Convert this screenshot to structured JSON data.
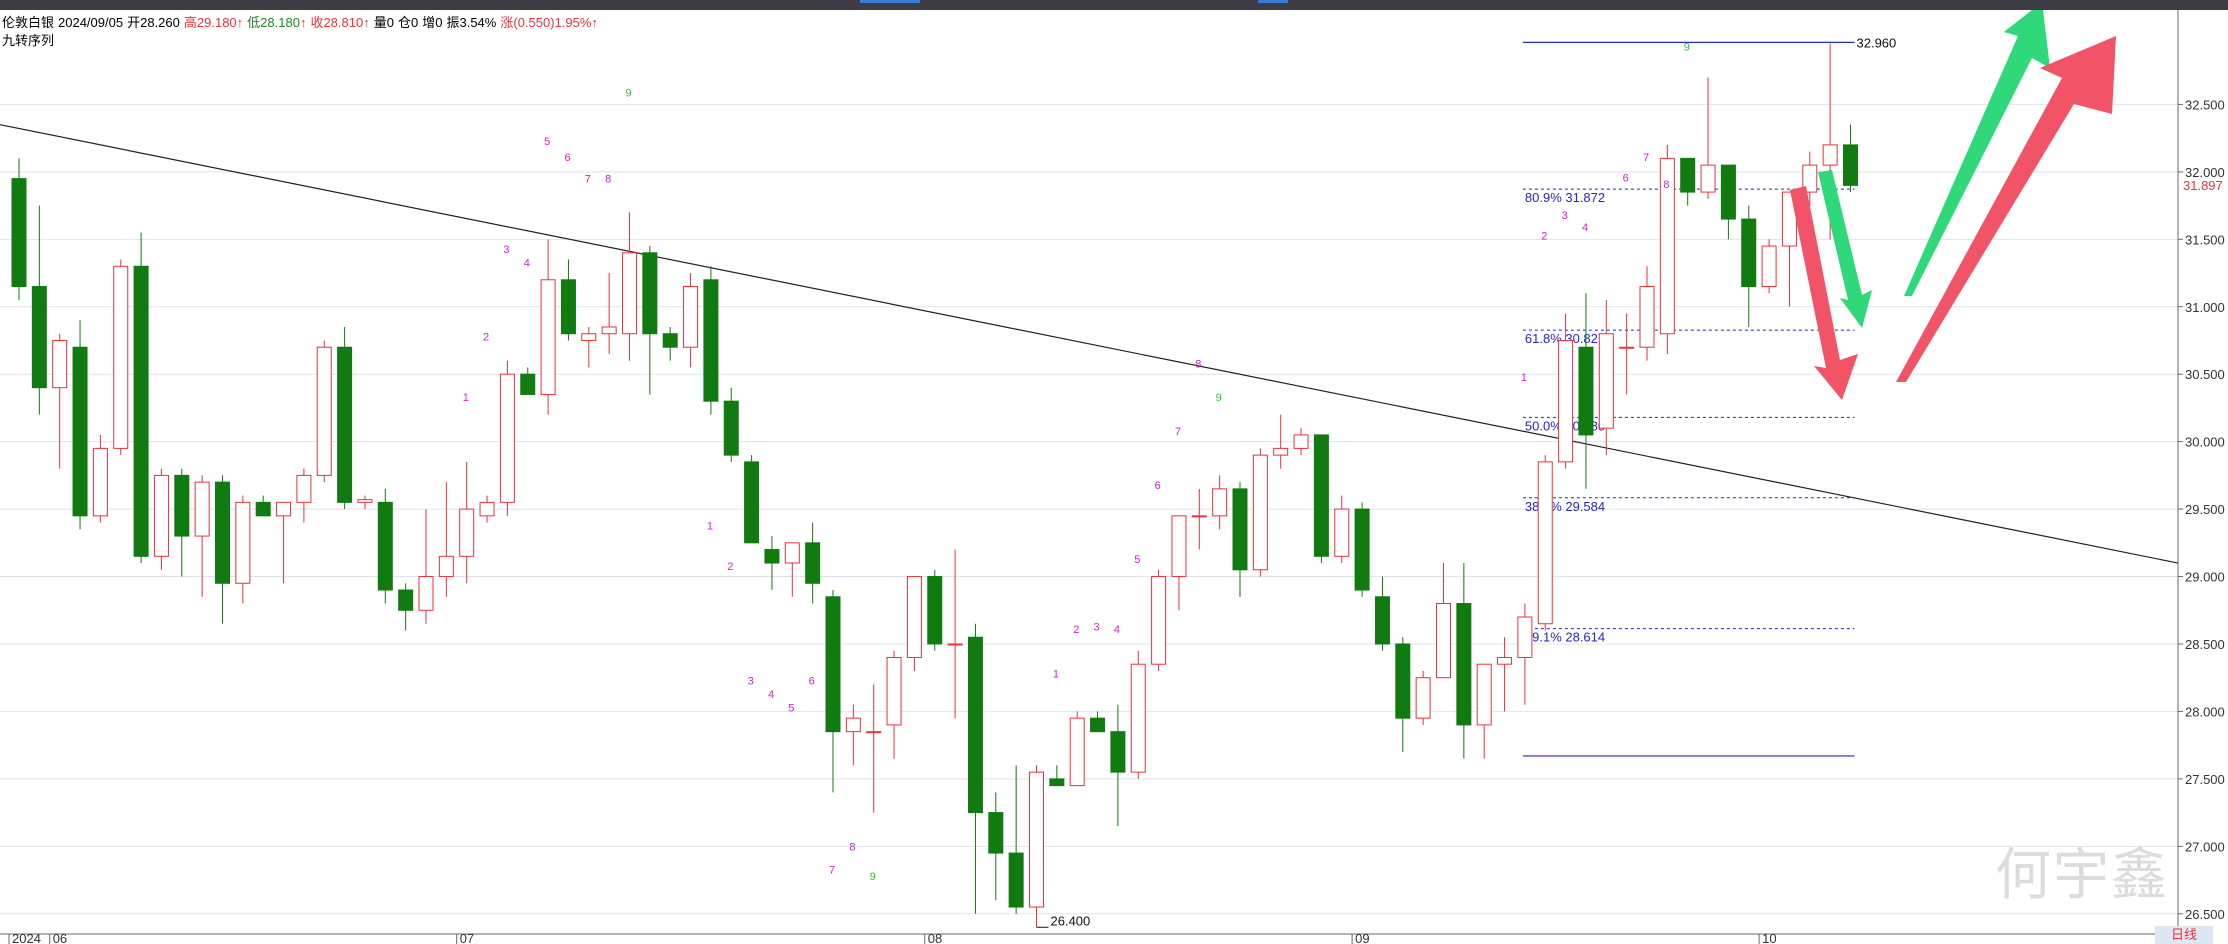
{
  "window": {
    "title_tabs": 2
  },
  "header": {
    "symbol": "伦敦白银",
    "date": "2024/09/05",
    "open_label": "开",
    "open": "28.260",
    "high_label": "高",
    "high": "29.180",
    "low_label": "低",
    "low": "28.180",
    "close_label": "收",
    "close": "28.810",
    "volume_label": "量",
    "volume": "0",
    "oi_label": "仓",
    "oi": "0",
    "inc_label": "增",
    "inc": "0",
    "amp_label": "振",
    "amp": "3.54%",
    "chg_label": "涨",
    "chg": "(0.550)1.95%",
    "up_arrow": "↑",
    "indicator": "九转序列"
  },
  "watermark": "何宇鑫",
  "period_badge": "日线",
  "colors": {
    "up": "#e8323c",
    "down": "#117a11",
    "fib": "#2525c8",
    "text_magenta": "#d21ed2",
    "text_green": "#25c825",
    "grid": "#dde3ee",
    "arrow_green": "#2fd97a",
    "arrow_red": "#f05466"
  },
  "chart_data": {
    "type": "candlestick",
    "y_axis": {
      "min": 26.35,
      "max": 33.2,
      "ticks": [
        "32.500",
        "32.000",
        "31.500",
        "31.000",
        "30.500",
        "30.000",
        "29.500",
        "29.000",
        "28.500",
        "28.000",
        "27.500",
        "27.000",
        "26.500"
      ],
      "current_price": "31.897",
      "position": "right"
    },
    "x_axis": {
      "labels": [
        {
          "text": "2024",
          "index": 0
        },
        {
          "text": "06",
          "index": 2
        },
        {
          "text": "07",
          "index": 22
        },
        {
          "text": "08",
          "index": 45
        },
        {
          "text": "09",
          "index": 66
        },
        {
          "text": "10",
          "index": 86
        }
      ]
    },
    "candles": [
      {
        "o": 31.95,
        "h": 32.1,
        "l": 31.05,
        "c": 31.15
      },
      {
        "o": 31.15,
        "h": 31.75,
        "l": 30.2,
        "c": 30.4
      },
      {
        "o": 30.4,
        "h": 30.8,
        "l": 29.8,
        "c": 30.75
      },
      {
        "o": 30.7,
        "h": 30.9,
        "l": 29.35,
        "c": 29.45
      },
      {
        "o": 29.45,
        "h": 30.05,
        "l": 29.4,
        "c": 29.95
      },
      {
        "o": 29.95,
        "h": 31.35,
        "l": 29.9,
        "c": 31.3
      },
      {
        "o": 31.3,
        "h": 31.55,
        "l": 29.1,
        "c": 29.15
      },
      {
        "o": 29.15,
        "h": 29.8,
        "l": 29.05,
        "c": 29.75
      },
      {
        "o": 29.75,
        "h": 29.8,
        "l": 29.0,
        "c": 29.3
      },
      {
        "o": 29.3,
        "h": 29.75,
        "l": 28.85,
        "c": 29.7
      },
      {
        "o": 29.7,
        "h": 29.75,
        "l": 28.65,
        "c": 28.95
      },
      {
        "o": 28.95,
        "h": 29.6,
        "l": 28.8,
        "c": 29.55
      },
      {
        "o": 29.55,
        "h": 29.6,
        "l": 29.45,
        "c": 29.45
      },
      {
        "o": 29.45,
        "h": 29.55,
        "l": 28.95,
        "c": 29.55
      },
      {
        "o": 29.55,
        "h": 29.8,
        "l": 29.4,
        "c": 29.75
      },
      {
        "o": 29.75,
        "h": 30.75,
        "l": 29.7,
        "c": 30.7
      },
      {
        "o": 30.7,
        "h": 30.85,
        "l": 29.5,
        "c": 29.55
      },
      {
        "o": 29.55,
        "h": 29.6,
        "l": 29.5,
        "c": 29.57
      },
      {
        "o": 29.55,
        "h": 29.65,
        "l": 28.8,
        "c": 28.9
      },
      {
        "o": 28.9,
        "h": 28.95,
        "l": 28.6,
        "c": 28.75
      },
      {
        "o": 28.75,
        "h": 29.5,
        "l": 28.65,
        "c": 29.0
      },
      {
        "o": 29.0,
        "h": 29.7,
        "l": 28.85,
        "c": 29.15
      },
      {
        "o": 29.15,
        "h": 29.85,
        "l": 28.95,
        "c": 29.5
      },
      {
        "o": 29.45,
        "h": 29.6,
        "l": 29.4,
        "c": 29.55
      },
      {
        "o": 29.55,
        "h": 30.6,
        "l": 29.45,
        "c": 30.5
      },
      {
        "o": 30.5,
        "h": 30.55,
        "l": 30.35,
        "c": 30.35
      },
      {
        "o": 30.35,
        "h": 31.5,
        "l": 30.2,
        "c": 31.2
      },
      {
        "o": 31.2,
        "h": 31.35,
        "l": 30.75,
        "c": 30.8
      },
      {
        "o": 30.75,
        "h": 30.85,
        "l": 30.55,
        "c": 30.8
      },
      {
        "o": 30.8,
        "h": 31.25,
        "l": 30.65,
        "c": 30.85
      },
      {
        "o": 30.8,
        "h": 31.7,
        "l": 30.6,
        "c": 31.4
      },
      {
        "o": 31.4,
        "h": 31.45,
        "l": 30.35,
        "c": 30.8
      },
      {
        "o": 30.8,
        "h": 30.85,
        "l": 30.6,
        "c": 30.7
      },
      {
        "o": 30.7,
        "h": 31.25,
        "l": 30.55,
        "c": 31.15
      },
      {
        "o": 31.2,
        "h": 31.3,
        "l": 30.2,
        "c": 30.3
      },
      {
        "o": 30.3,
        "h": 30.4,
        "l": 29.85,
        "c": 29.9
      },
      {
        "o": 29.85,
        "h": 29.9,
        "l": 29.25,
        "c": 29.25
      },
      {
        "o": 29.2,
        "h": 29.3,
        "l": 28.9,
        "c": 29.1
      },
      {
        "o": 29.1,
        "h": 29.25,
        "l": 28.85,
        "c": 29.25
      },
      {
        "o": 29.25,
        "h": 29.4,
        "l": 28.8,
        "c": 28.95
      },
      {
        "o": 28.85,
        "h": 28.9,
        "l": 27.4,
        "c": 27.85
      },
      {
        "o": 27.85,
        "h": 28.05,
        "l": 27.6,
        "c": 27.95
      },
      {
        "o": 27.85,
        "h": 28.2,
        "l": 27.25,
        "c": 27.85
      },
      {
        "o": 27.9,
        "h": 28.45,
        "l": 27.65,
        "c": 28.4
      },
      {
        "o": 28.4,
        "h": 29.0,
        "l": 28.3,
        "c": 29.0
      },
      {
        "o": 29.0,
        "h": 29.05,
        "l": 28.45,
        "c": 28.5
      },
      {
        "o": 28.5,
        "h": 29.2,
        "l": 27.95,
        "c": 28.5
      },
      {
        "o": 28.55,
        "h": 28.65,
        "l": 26.5,
        "c": 27.25
      },
      {
        "o": 27.25,
        "h": 27.4,
        "l": 26.6,
        "c": 26.95
      },
      {
        "o": 26.95,
        "h": 27.6,
        "l": 26.5,
        "c": 26.55
      },
      {
        "o": 26.55,
        "h": 27.6,
        "l": 26.4,
        "c": 27.55
      },
      {
        "o": 27.5,
        "h": 27.6,
        "l": 27.45,
        "c": 27.45
      },
      {
        "o": 27.45,
        "h": 28.0,
        "l": 27.45,
        "c": 27.95
      },
      {
        "o": 27.95,
        "h": 28.0,
        "l": 27.85,
        "c": 27.85
      },
      {
        "o": 27.85,
        "h": 28.05,
        "l": 27.15,
        "c": 27.55
      },
      {
        "o": 27.55,
        "h": 28.45,
        "l": 27.5,
        "c": 28.35
      },
      {
        "o": 28.35,
        "h": 29.05,
        "l": 28.3,
        "c": 29.0
      },
      {
        "o": 29.0,
        "h": 29.45,
        "l": 28.75,
        "c": 29.45
      },
      {
        "o": 29.45,
        "h": 29.65,
        "l": 29.2,
        "c": 29.45
      },
      {
        "o": 29.45,
        "h": 29.75,
        "l": 29.35,
        "c": 29.65
      },
      {
        "o": 29.65,
        "h": 29.7,
        "l": 28.85,
        "c": 29.05
      },
      {
        "o": 29.05,
        "h": 29.95,
        "l": 29.0,
        "c": 29.9
      },
      {
        "o": 29.9,
        "h": 30.2,
        "l": 29.8,
        "c": 29.95
      },
      {
        "o": 29.95,
        "h": 30.1,
        "l": 29.9,
        "c": 30.05
      },
      {
        "o": 30.05,
        "h": 30.05,
        "l": 29.1,
        "c": 29.15
      },
      {
        "o": 29.15,
        "h": 29.6,
        "l": 29.1,
        "c": 29.5
      },
      {
        "o": 29.5,
        "h": 29.55,
        "l": 28.85,
        "c": 28.9
      },
      {
        "o": 28.85,
        "h": 29.0,
        "l": 28.45,
        "c": 28.5
      },
      {
        "o": 28.5,
        "h": 28.55,
        "l": 27.7,
        "c": 27.95
      },
      {
        "o": 27.95,
        "h": 28.3,
        "l": 27.9,
        "c": 28.25
      },
      {
        "o": 28.25,
        "h": 29.1,
        "l": 28.25,
        "c": 28.8
      },
      {
        "o": 28.8,
        "h": 29.1,
        "l": 27.65,
        "c": 27.9
      },
      {
        "o": 27.9,
        "h": 28.35,
        "l": 27.65,
        "c": 28.35
      },
      {
        "o": 28.35,
        "h": 28.55,
        "l": 28.0,
        "c": 28.4
      },
      {
        "o": 28.4,
        "h": 28.8,
        "l": 28.05,
        "c": 28.7
      },
      {
        "o": 28.65,
        "h": 29.9,
        "l": 28.6,
        "c": 29.85
      },
      {
        "o": 29.85,
        "h": 30.95,
        "l": 29.8,
        "c": 30.75
      },
      {
        "o": 30.7,
        "h": 31.1,
        "l": 29.65,
        "c": 30.05
      },
      {
        "o": 30.1,
        "h": 31.05,
        "l": 29.9,
        "c": 30.8
      },
      {
        "o": 30.7,
        "h": 30.95,
        "l": 30.35,
        "c": 30.7
      },
      {
        "o": 30.7,
        "h": 31.3,
        "l": 30.6,
        "c": 31.15
      },
      {
        "o": 30.8,
        "h": 32.2,
        "l": 30.65,
        "c": 32.1
      },
      {
        "o": 32.1,
        "h": 32.1,
        "l": 31.75,
        "c": 31.85
      },
      {
        "o": 31.85,
        "h": 32.7,
        "l": 31.8,
        "c": 32.05
      },
      {
        "o": 32.05,
        "h": 32.05,
        "l": 31.5,
        "c": 31.65
      },
      {
        "o": 31.65,
        "h": 31.75,
        "l": 30.85,
        "c": 31.15
      },
      {
        "o": 31.15,
        "h": 31.5,
        "l": 31.1,
        "c": 31.45
      },
      {
        "o": 31.45,
        "h": 31.85,
        "l": 31.0,
        "c": 31.85
      },
      {
        "o": 31.85,
        "h": 32.15,
        "l": 31.75,
        "c": 32.05
      },
      {
        "o": 32.05,
        "h": 32.95,
        "l": 31.5,
        "c": 32.2
      },
      {
        "o": 32.2,
        "h": 32.35,
        "l": 31.85,
        "c": 31.9
      }
    ],
    "fib_levels": [
      {
        "label": "80.9% 31.872",
        "value": 31.872
      },
      {
        "label": "61.8% 30.827",
        "value": 30.827
      },
      {
        "label": "50.0% 30.180",
        "value": 30.18
      },
      {
        "label": "38.2% 29.584",
        "value": 29.584
      },
      {
        "label": "19.1% 28.614",
        "value": 28.614
      }
    ],
    "fib_bounds": {
      "high": 32.96,
      "low": 27.67,
      "high_label": "32.960",
      "start_index": 74,
      "end_index": 90
    },
    "low_marker": {
      "label": "26.400",
      "index": 50,
      "value": 26.4
    },
    "trendline": {
      "y_start": 32.35,
      "y_end": 29.1
    },
    "td_marks": [
      {
        "t": "5",
        "i": 26,
        "v": 32.2,
        "c": "m"
      },
      {
        "t": "6",
        "i": 27,
        "v": 32.08,
        "c": "m"
      },
      {
        "t": "7",
        "i": 28,
        "v": 31.92,
        "c": "m"
      },
      {
        "t": "8",
        "i": 29,
        "v": 31.92,
        "c": "m"
      },
      {
        "t": "9",
        "i": 30,
        "v": 32.56,
        "c": "g"
      },
      {
        "t": "3",
        "i": 24,
        "v": 31.4,
        "c": "m"
      },
      {
        "t": "4",
        "i": 25,
        "v": 31.3,
        "c": "m"
      },
      {
        "t": "2",
        "i": 23,
        "v": 30.75,
        "c": "m"
      },
      {
        "t": "1",
        "i": 22,
        "v": 30.3,
        "c": "m"
      },
      {
        "t": "1",
        "i": 34,
        "v": 29.35,
        "c": "m"
      },
      {
        "t": "2",
        "i": 35,
        "v": 29.05,
        "c": "m"
      },
      {
        "t": "3",
        "i": 36,
        "v": 28.2,
        "c": "m"
      },
      {
        "t": "4",
        "i": 37,
        "v": 28.1,
        "c": "m"
      },
      {
        "t": "5",
        "i": 38,
        "v": 28.0,
        "c": "m"
      },
      {
        "t": "6",
        "i": 39,
        "v": 28.2,
        "c": "m"
      },
      {
        "t": "7",
        "i": 40,
        "v": 26.8,
        "c": "m"
      },
      {
        "t": "8",
        "i": 41,
        "v": 26.97,
        "c": "m"
      },
      {
        "t": "9",
        "i": 42,
        "v": 26.75,
        "c": "g"
      },
      {
        "t": "1",
        "i": 51,
        "v": 28.25,
        "c": "m"
      },
      {
        "t": "2",
        "i": 52,
        "v": 28.58,
        "c": "m"
      },
      {
        "t": "3",
        "i": 53,
        "v": 28.6,
        "c": "m"
      },
      {
        "t": "4",
        "i": 54,
        "v": 28.58,
        "c": "m"
      },
      {
        "t": "5",
        "i": 55,
        "v": 29.1,
        "c": "m"
      },
      {
        "t": "6",
        "i": 56,
        "v": 29.65,
        "c": "m"
      },
      {
        "t": "7",
        "i": 57,
        "v": 30.05,
        "c": "m"
      },
      {
        "t": "8",
        "i": 58,
        "v": 30.55,
        "c": "m"
      },
      {
        "t": "9",
        "i": 59,
        "v": 30.3,
        "c": "g"
      },
      {
        "t": "1",
        "i": 74,
        "v": 30.45,
        "c": "m"
      },
      {
        "t": "2",
        "i": 75,
        "v": 31.5,
        "c": "m"
      },
      {
        "t": "3",
        "i": 76,
        "v": 31.65,
        "c": "m"
      },
      {
        "t": "4",
        "i": 77,
        "v": 31.56,
        "c": "m"
      },
      {
        "t": "6",
        "i": 79,
        "v": 31.93,
        "c": "m"
      },
      {
        "t": "7",
        "i": 80,
        "v": 32.08,
        "c": "m"
      },
      {
        "t": "8",
        "i": 81,
        "v": 31.88,
        "c": "m"
      },
      {
        "t": "9",
        "i": 82,
        "v": 32.9,
        "c": "g"
      }
    ]
  }
}
